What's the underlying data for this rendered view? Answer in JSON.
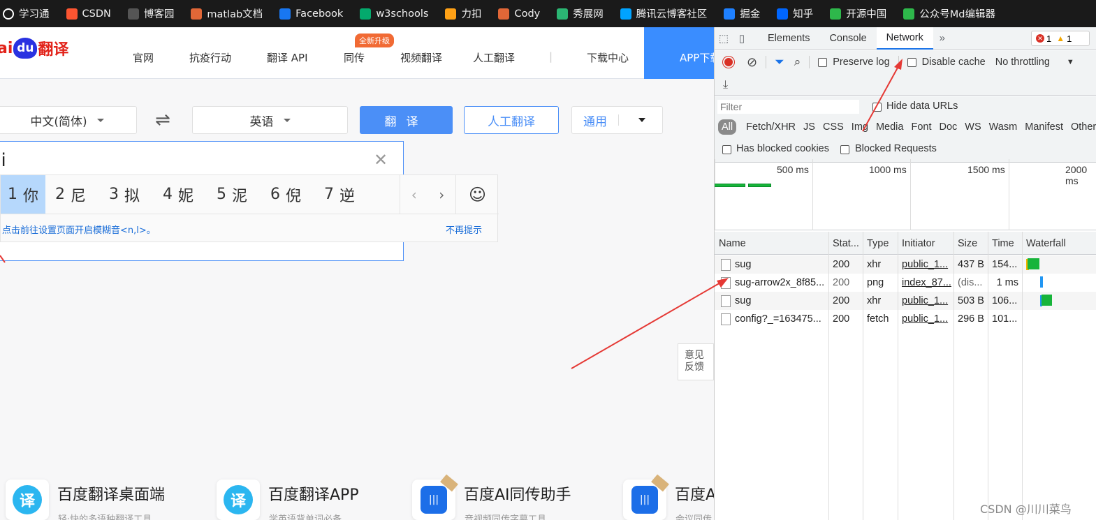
{
  "bookmarks": [
    {
      "label": "学习通",
      "icon": "globe-icon",
      "color": "#ffffff"
    },
    {
      "label": "CSDN",
      "icon": "csdn-icon",
      "color": "#fc5531"
    },
    {
      "label": "博客园",
      "icon": "cnblogs-icon",
      "color": "#555555"
    },
    {
      "label": "matlab文档",
      "icon": "matlab-icon",
      "color": "#e16737"
    },
    {
      "label": "Facebook",
      "icon": "facebook-icon",
      "color": "#1877f2"
    },
    {
      "label": "w3schools",
      "icon": "w3schools-icon",
      "color": "#04aa6d"
    },
    {
      "label": "力扣",
      "icon": "leetcode-icon",
      "color": "#ffa116"
    },
    {
      "label": "Cody",
      "icon": "cody-icon",
      "color": "#e16737"
    },
    {
      "label": "秀展网",
      "icon": "xiuzhan-icon",
      "color": "#2bb673"
    },
    {
      "label": "腾讯云博客社区",
      "icon": "tencent-cloud-icon",
      "color": "#00a3ff"
    },
    {
      "label": "掘金",
      "icon": "juejin-icon",
      "color": "#1e80ff"
    },
    {
      "label": "知乎",
      "icon": "zhihu-icon",
      "color": "#0066ff"
    },
    {
      "label": "开源中国",
      "icon": "oschina-icon",
      "color": "#2eb84b"
    },
    {
      "label": "公众号Md编辑器",
      "icon": "md-editor-icon",
      "color": "#2eb84b"
    }
  ],
  "site": {
    "logo_text_left": "ai",
    "logo_du": "du",
    "logo_text_right": "翻译",
    "nav": [
      "官网",
      "抗疫行动",
      "翻译 API",
      "同传",
      "视频翻译",
      "人工翻译",
      "|",
      "下载中心"
    ],
    "badge": "全新升级",
    "app_button": "APP下载",
    "source_lang": "中文(简体)",
    "target_lang": "英语",
    "translate_btn": "翻译",
    "human_btn": "人工翻译",
    "domain_btn": "通用",
    "input_text": "ni",
    "ime_candidates": [
      {
        "n": "1",
        "c": "你"
      },
      {
        "n": "2",
        "c": "尼"
      },
      {
        "n": "3",
        "c": "拟"
      },
      {
        "n": "4",
        "c": "妮"
      },
      {
        "n": "5",
        "c": "泥"
      },
      {
        "n": "6",
        "c": "倪"
      },
      {
        "n": "7",
        "c": "逆"
      }
    ],
    "ime_tip": "点击前往设置页面开启模糊音<n,l>。",
    "ime_dismiss": "不再提示",
    "feedback": "意见 反馈",
    "products": [
      {
        "title": "百度翻译桌面端",
        "sub": "轻·快的多语种翻译工具"
      },
      {
        "title": "百度翻译APP",
        "sub": "学英语背单词必备"
      },
      {
        "title": "百度AI同传助手",
        "sub": "音视频同传字幕工具"
      },
      {
        "title": "百度AI",
        "sub": "会议同传"
      }
    ]
  },
  "devtools": {
    "tabs": [
      "Elements",
      "Console",
      "Network"
    ],
    "errors": "1",
    "warnings": "1",
    "preserve_log": "Preserve log",
    "disable_cache": "Disable cache",
    "throttling": "No throttling",
    "filter_placeholder": "Filter",
    "hide_data_urls": "Hide data URLs",
    "types": [
      "All",
      "Fetch/XHR",
      "JS",
      "CSS",
      "Img",
      "Media",
      "Font",
      "Doc",
      "WS",
      "Wasm",
      "Manifest",
      "Other"
    ],
    "blocked_cookies": "Has blocked cookies",
    "blocked_requests": "Blocked Requests",
    "timeline_ticks": [
      "500 ms",
      "1000 ms",
      "1500 ms",
      "2000 ms"
    ],
    "columns": [
      "Name",
      "Stat...",
      "Type",
      "Initiator",
      "Size",
      "Time",
      "Waterfall"
    ],
    "rows": [
      {
        "name": "sug",
        "status": "200",
        "type": "xhr",
        "initiator": "public_1...",
        "size": "437 B",
        "time": "154..."
      },
      {
        "name": "sug-arrow2x_8f85...",
        "status": "200",
        "type": "png",
        "initiator": "index_87...",
        "size": "(dis...",
        "time": "1 ms"
      },
      {
        "name": "sug",
        "status": "200",
        "type": "xhr",
        "initiator": "public_1...",
        "size": "503 B",
        "time": "106..."
      },
      {
        "name": "config?_=163475...",
        "status": "200",
        "type": "fetch",
        "initiator": "public_1...",
        "size": "296 B",
        "time": "101..."
      }
    ]
  },
  "watermark": "CSDN @川川菜鸟"
}
